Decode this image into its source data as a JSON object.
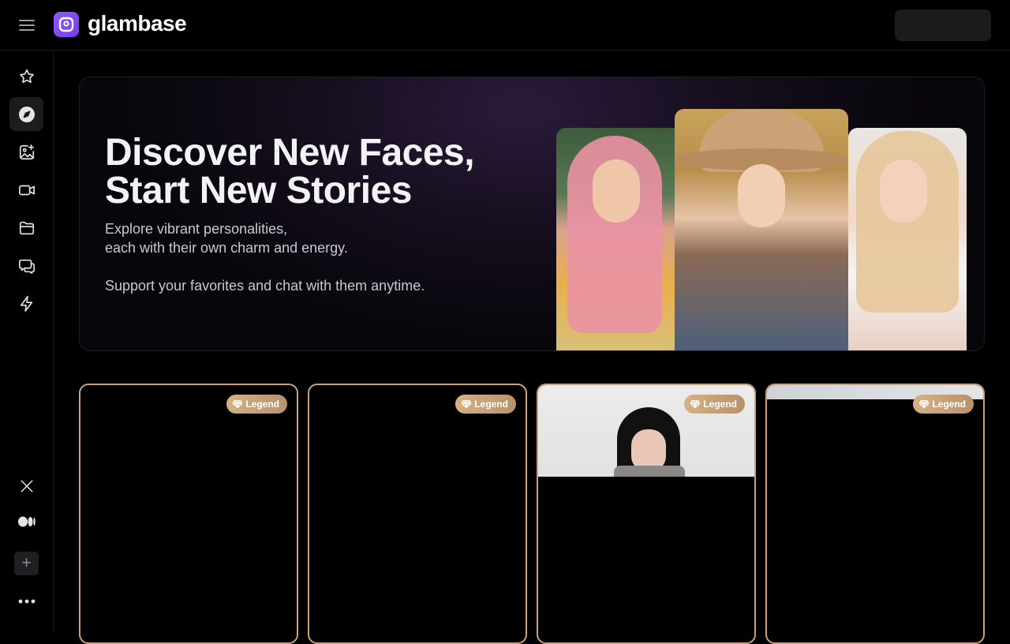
{
  "app": {
    "brand": "glambase"
  },
  "hero": {
    "title_line1": "Discover New Faces,",
    "title_line2": "Start New Stories",
    "sub_line1": "Explore vibrant personalities,",
    "sub_line2": "each with their own charm and energy.",
    "sub_line3": "Support your favorites and chat with them anytime."
  },
  "sidebar": {
    "items": [
      {
        "icon": "star-icon",
        "active": false
      },
      {
        "icon": "compass-icon",
        "active": true
      },
      {
        "icon": "image-sparkle-icon",
        "active": false
      },
      {
        "icon": "video-icon",
        "active": false
      },
      {
        "icon": "folder-icon",
        "active": false
      },
      {
        "icon": "chat-icon",
        "active": false
      },
      {
        "icon": "lightning-icon",
        "active": false
      }
    ],
    "social": [
      "x-icon",
      "medium-icon"
    ],
    "plus": "+",
    "more": "more-icon"
  },
  "cards": [
    {
      "badge": "Legend"
    },
    {
      "badge": "Legend"
    },
    {
      "badge": "Legend"
    },
    {
      "badge": "Legend"
    }
  ],
  "colors": {
    "accent": "#8b5cf6",
    "card_border": "#c9a27a",
    "badge": "#c9a27a"
  }
}
